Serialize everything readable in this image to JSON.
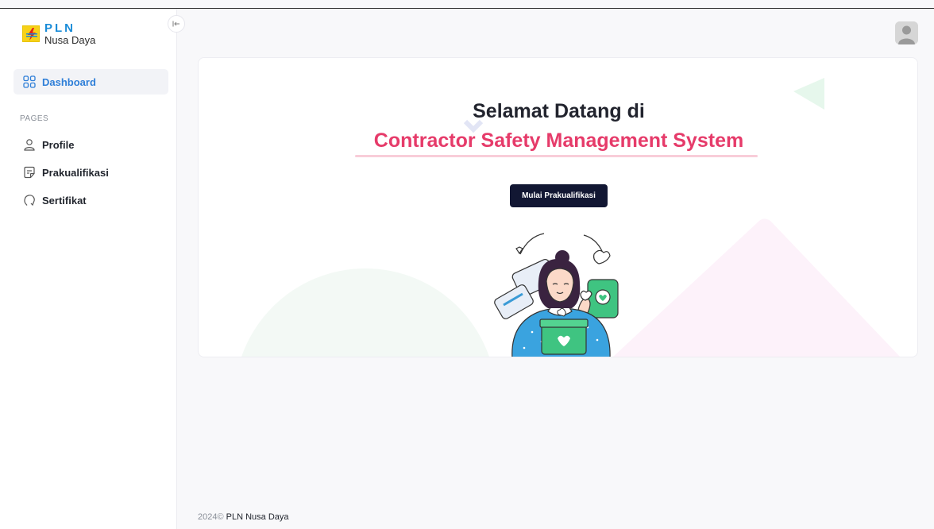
{
  "brand": {
    "name": "PLN",
    "subtitle": "Nusa Daya"
  },
  "sidebar": {
    "dashboard_label": "Dashboard",
    "section_label": "PAGES",
    "items": [
      {
        "label": "Profile",
        "icon": "user-icon"
      },
      {
        "label": "Prakualifikasi",
        "icon": "sticky-note-icon"
      },
      {
        "label": "Sertifikat",
        "icon": "certificate-icon"
      }
    ]
  },
  "hero": {
    "title": "Selamat Datang di",
    "subtitle": "Contractor Safety Management System",
    "cta_label": "Mulai Prakualifikasi"
  },
  "footer": {
    "year": "2024©",
    "company": "PLN Nusa Daya"
  },
  "colors": {
    "accent": "#e63b6a",
    "brand_blue": "#1a8cd8",
    "button": "#121733",
    "logo_yellow": "#f7d117"
  }
}
